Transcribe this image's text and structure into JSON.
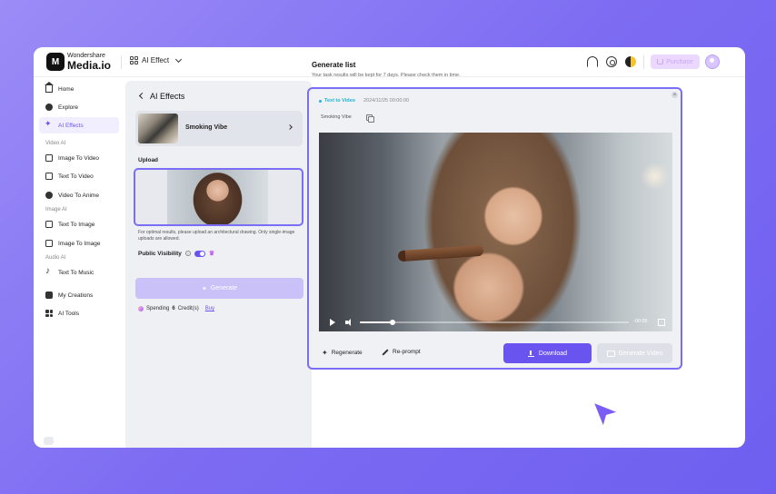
{
  "header": {
    "logo_mark": "M",
    "logo_top": "Wondershare",
    "logo_bottom": "Media.io",
    "menu_label": "AI Effect",
    "purchase_label": "Purchase",
    "icons": [
      "headset-icon",
      "gear-icon",
      "theme-icon",
      "cart-icon",
      "avatar"
    ]
  },
  "sidebar": {
    "items": [
      {
        "label": "Home",
        "icon": "home-icon"
      },
      {
        "label": "Explore",
        "icon": "compass-icon"
      },
      {
        "label": "AI Effects",
        "icon": "sparkle-icon",
        "active": true
      }
    ],
    "groups": {
      "video_ai": "Video AI",
      "image_ai": "Image AI",
      "audio_ai": "Audio AI"
    },
    "video_items": [
      {
        "label": "Image To Video"
      },
      {
        "label": "Text To Video"
      },
      {
        "label": "Video To Anime"
      }
    ],
    "image_items": [
      {
        "label": "Text To Image"
      },
      {
        "label": "Image To Image"
      }
    ],
    "audio_items": [
      {
        "label": "Text To Music"
      }
    ],
    "bottom_items": [
      {
        "label": "My Creations"
      },
      {
        "label": "AI Tools"
      }
    ]
  },
  "panel": {
    "title": "AI Effects",
    "effect_name": "Smoking Vibe",
    "upload_label": "Upload",
    "upload_hint": "For optimal results, please upload an architectural drawing. Only single-image uploads are allowed.",
    "public_visibility_label": "Public Visibility",
    "generate_label": "Generate",
    "spending_prefix": "Spending",
    "spending_amount": "6",
    "spending_suffix": "Credit(s)",
    "buy_label": "Buy"
  },
  "generate_list": {
    "title": "Generate list",
    "subtitle": "Your task results will be kept for 7 days. Please check them in time.",
    "task": {
      "tag": "Text to Video",
      "timestamp": "2024/11/25  00:00:00",
      "effect": "Smoking Vibe",
      "video_time": "-00:05",
      "progress": 0.12,
      "regenerate_label": "Regenerate",
      "reprompt_label": "Re-prompt",
      "download_label": "Download",
      "generate_video_label": "Generate Video"
    }
  },
  "colors": {
    "accent": "#6a54f0",
    "accent_light": "#c9c1f8",
    "tag": "#1fb3d6",
    "border_highlight": "#7b6ef6"
  }
}
